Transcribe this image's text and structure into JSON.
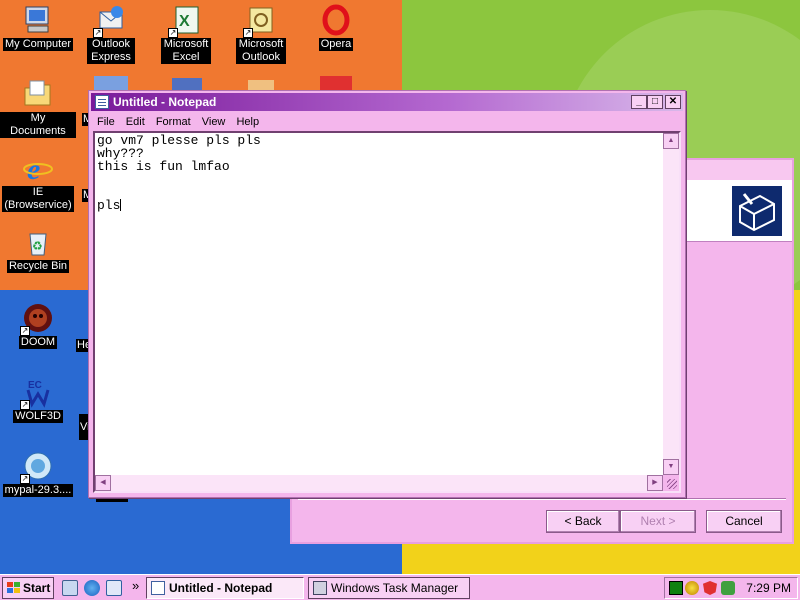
{
  "desktop": {
    "icons": [
      {
        "label": "My Computer",
        "icon": "my-computer-icon"
      },
      {
        "label": "Outlook Express",
        "icon": "outlook-express-icon"
      },
      {
        "label": "Microsoft Excel",
        "icon": "excel-icon"
      },
      {
        "label": "Microsoft Outlook",
        "icon": "outlook-icon"
      },
      {
        "label": "Opera",
        "icon": "opera-icon"
      },
      {
        "label": "My Documents",
        "icon": "my-documents-icon"
      },
      {
        "label": "IE (Browservice)",
        "icon": "internet-explorer-icon"
      },
      {
        "label": "Recycle Bin",
        "icon": "recycle-bin-icon"
      },
      {
        "label": "DOOM",
        "icon": "doom-icon"
      },
      {
        "label": "WOLF3D",
        "icon": "wolf3d-icon"
      },
      {
        "label": "mypal-29.3....",
        "icon": "mypal-icon"
      }
    ],
    "partial_labels": {
      "m1": "M",
      "m2": "M",
      "he": "He",
      "vi": "Vi"
    }
  },
  "wizard": {
    "back_label": "< Back",
    "next_label": "Next >",
    "cancel_label": "Cancel"
  },
  "notepad": {
    "title": "Untitled - Notepad",
    "menu": [
      "File",
      "Edit",
      "Format",
      "View",
      "Help"
    ],
    "text": "go vm7 plesse pls pls\nwhy???\nthis is fun lmfao\n\n\npls"
  },
  "taskbar": {
    "start_label": "Start",
    "tasks": [
      {
        "label": "Untitled - Notepad",
        "active": true
      },
      {
        "label": "Windows Task Manager",
        "active": false
      }
    ],
    "chevron": "»",
    "clock": "7:29 PM"
  },
  "colors": {
    "window_face": "#f4b6ec",
    "titlebar_active": "#7a1a9a",
    "quad_orange": "#f07830",
    "quad_green": "#8cc63e",
    "quad_blue": "#2a6ad2",
    "quad_yellow": "#f2d21a"
  }
}
